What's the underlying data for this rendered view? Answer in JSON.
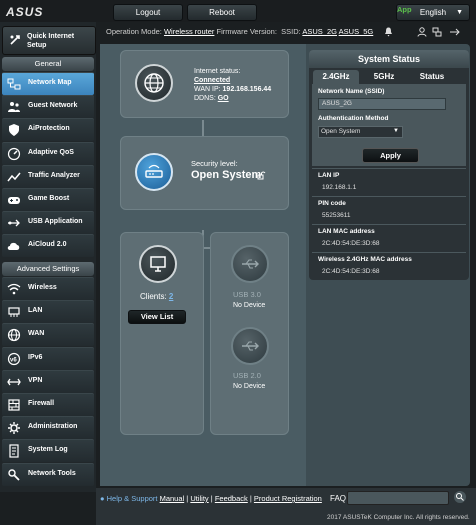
{
  "brand": "ASUS",
  "topbar": {
    "logout_label": "Logout",
    "reboot_label": "Reboot",
    "language": "English"
  },
  "infobar": {
    "op_mode_label": "Operation Mode:",
    "op_mode_value": "Wireless router",
    "firmware_label": "Firmware Version:",
    "ssid_label": "SSID:",
    "ssid_24": "ASUS_2G",
    "ssid_5": "ASUS_5G",
    "app_label": "App"
  },
  "sidebar": {
    "quick_setup": "Quick Internet Setup",
    "general_header": "General",
    "general_items": [
      {
        "label": "Network Map",
        "icon": "network-map-icon"
      },
      {
        "label": "Guest Network",
        "icon": "guest-network-icon"
      },
      {
        "label": "AiProtection",
        "icon": "aiprotection-icon"
      },
      {
        "label": "Adaptive QoS",
        "icon": "qos-icon"
      },
      {
        "label": "Traffic Analyzer",
        "icon": "traffic-analyzer-icon"
      },
      {
        "label": "Game Boost",
        "icon": "game-boost-icon"
      },
      {
        "label": "USB Application",
        "icon": "usb-application-icon"
      },
      {
        "label": "AiCloud 2.0",
        "icon": "aicloud-icon"
      }
    ],
    "advanced_header": "Advanced Settings",
    "advanced_items": [
      {
        "label": "Wireless",
        "icon": "wireless-icon"
      },
      {
        "label": "LAN",
        "icon": "lan-icon"
      },
      {
        "label": "WAN",
        "icon": "wan-icon"
      },
      {
        "label": "IPv6",
        "icon": "ipv6-icon"
      },
      {
        "label": "VPN",
        "icon": "vpn-icon"
      },
      {
        "label": "Firewall",
        "icon": "firewall-icon"
      },
      {
        "label": "Administration",
        "icon": "administration-icon"
      },
      {
        "label": "System Log",
        "icon": "system-log-icon"
      },
      {
        "label": "Network Tools",
        "icon": "network-tools-icon"
      }
    ]
  },
  "map": {
    "internet_status_label": "Internet status:",
    "internet_status_value": "Connected",
    "wan_ip_label": "WAN IP:",
    "wan_ip_value": "192.168.156.44",
    "ddns_label": "DDNS:",
    "ddns_value": "GO",
    "security_label": "Security level:",
    "security_value": "Open System",
    "clients_label": "Clients:",
    "clients_count": "2",
    "view_list_label": "View List",
    "usb1_label": "USB 3.0",
    "usb1_status": "No Device",
    "usb2_label": "USB 2.0",
    "usb2_status": "No Device"
  },
  "status": {
    "title": "System Status",
    "tabs": [
      "2.4GHz",
      "5GHz",
      "Status"
    ],
    "ssid_label": "Network Name (SSID)",
    "ssid_value": "ASUS_2G",
    "auth_label": "Authentication Method",
    "auth_value": "Open System",
    "apply_label": "Apply",
    "lan_ip_label": "LAN IP",
    "lan_ip_value": "192.168.1.1",
    "pin_label": "PIN code",
    "pin_value": "55253611",
    "lan_mac_label": "LAN MAC address",
    "lan_mac_value": "2C:4D:54:DE:3D:68",
    "wl_mac_label": "Wireless 2.4GHz MAC address",
    "wl_mac_value": "2C:4D:54:DE:3D:68"
  },
  "footer": {
    "help_label": "Help & Support",
    "manual": "Manual",
    "utility": "Utility",
    "feedback": "Feedback",
    "product_registration": "Product Registration",
    "sep": "|",
    "faq_label": "FAQ",
    "copyright": "2017 ASUSTeK Computer Inc. All rights reserved."
  },
  "colors": {
    "active_menu": "#4a97cf",
    "app_green": "#5ac04a",
    "link_blue": "#7db7e8"
  }
}
